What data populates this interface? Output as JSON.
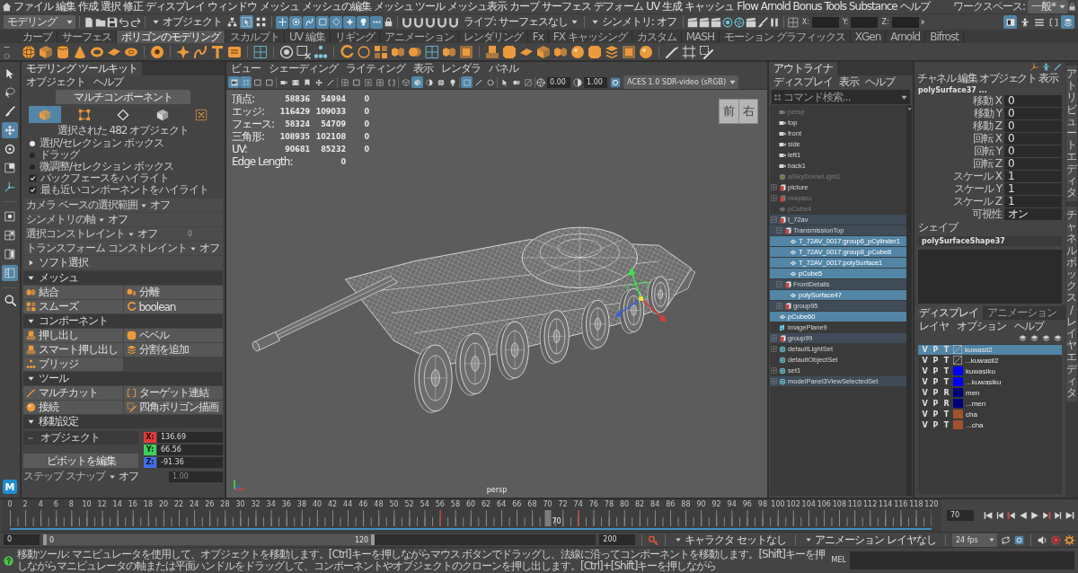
{
  "menu_bar": {
    "items": [
      "ファイル",
      "編集",
      "作成",
      "選択",
      "修正",
      "ディスプレイ",
      "ウィンドウ",
      "メッシュ",
      "メッシュの編集",
      "メッシュ ツール",
      "メッシュ表示",
      "カーブ",
      "サーフェス",
      "デフォーム",
      "UV",
      "生成",
      "キャッシュ",
      "Flow",
      "Arnold",
      "Bonus Tools",
      "Substance",
      "ヘルプ"
    ],
    "workspace_label": "ワークスペース:",
    "workspace": "一般*"
  },
  "status_line": {
    "mode": "モデリング",
    "selection_type": "オブジェクト",
    "select_modes": [
      {
        "kind": "hierarchy",
        "selected": false
      },
      {
        "kind": "arrow-box",
        "selected": true
      },
      {
        "kind": "dots-box",
        "selected": false
      }
    ],
    "masks": [
      {
        "kind": "cross",
        "on": true
      },
      {
        "kind": "dot-circle",
        "on": true
      },
      {
        "kind": "swirl",
        "on": true
      },
      {
        "kind": "square",
        "on": true
      },
      {
        "kind": "diamond",
        "on": true
      },
      {
        "kind": "sparkle",
        "on": true
      },
      {
        "kind": "bulb",
        "on": true
      },
      {
        "kind": "dots",
        "on": true
      }
    ],
    "live_surface": "ライブ: サーフェスなし",
    "symmetry": "シンメトリ: オフ",
    "coordinate_labels": [
      "X:",
      "Y:",
      "Z:"
    ],
    "panel_toggles": [
      {
        "kind": "view",
        "on": true
      },
      {
        "kind": "person",
        "on": false
      },
      {
        "kind": "lines",
        "on": false
      },
      {
        "kind": "bracket",
        "on": false
      },
      {
        "kind": "stack",
        "on": true
      }
    ]
  },
  "shelf": {
    "tabs": [
      {
        "label": "カーブ",
        "selected": false
      },
      {
        "label": "サーフェス",
        "selected": false
      },
      {
        "label": "ポリゴンのモデリング",
        "selected": true
      },
      {
        "label": "スカルプト",
        "selected": false
      },
      {
        "label": "UV 編集",
        "selected": false
      },
      {
        "label": "リギング",
        "selected": false
      },
      {
        "label": "アニメーション",
        "selected": false
      },
      {
        "label": "レンダリング",
        "selected": false
      },
      {
        "label": "Fx",
        "selected": false
      },
      {
        "label": "FX キャッシング",
        "selected": false
      },
      {
        "label": "カスタム",
        "selected": false
      },
      {
        "label": "MASH",
        "selected": false
      },
      {
        "label": "モーション グラフィックス",
        "selected": false
      },
      {
        "label": "XGen",
        "selected": false
      },
      {
        "label": "Arnold",
        "selected": false
      },
      {
        "label": "Bifrost",
        "selected": false
      }
    ]
  },
  "toolbox": {
    "tools": [
      {
        "kind": "arrow",
        "selected": false
      },
      {
        "kind": "lasso",
        "selected": false
      },
      {
        "kind": "brush",
        "selected": false
      },
      {
        "kind": "move",
        "selected": true
      },
      {
        "kind": "rotate",
        "selected": false
      },
      {
        "kind": "scale",
        "selected": false
      },
      {
        "kind": "axes",
        "selected": false
      }
    ],
    "layouts": [
      {
        "kind": "view-single",
        "selected": false
      },
      {
        "kind": "view-four",
        "selected": false
      },
      {
        "kind": "view-two",
        "selected": false
      },
      {
        "kind": "view-outliner",
        "selected": true
      }
    ],
    "logo": "M"
  },
  "modeling_toolkit": {
    "title": "モデリング ツールキット",
    "menu": [
      "オブジェクト",
      "ヘルプ"
    ],
    "multi_component": "マルチコンポーネント",
    "modes": [
      {
        "kind": "object",
        "selected": true
      },
      {
        "kind": "vertex",
        "selected": false
      },
      {
        "kind": "edge",
        "selected": false
      },
      {
        "kind": "face",
        "selected": false
      },
      {
        "kind": "uv",
        "selected": false
      }
    ],
    "selection_info": "選択された 482 オブジェクト",
    "pick_styles": [
      {
        "label": "選択/セレクション ボックス",
        "selected": true
      },
      {
        "label": "ドラッグ",
        "selected": false
      },
      {
        "label": "微調整/セレクション ボックス",
        "selected": false
      }
    ],
    "highlights": [
      {
        "label": "バックフェースをハイライト",
        "checked": true
      },
      {
        "label": "最も近いコンポーネントをハイライト",
        "checked": true
      }
    ],
    "settings": [
      {
        "label": "カメラ ベースの選択範囲",
        "value": "オフ"
      },
      {
        "label": "シンメトリの軸",
        "value": "オフ"
      },
      {
        "label": "選択コンストレイント",
        "value": "オフ",
        "amount": "0"
      },
      {
        "label": "トランスフォーム コンストレイント",
        "value": "オフ"
      }
    ],
    "sections": [
      {
        "kind": "options",
        "title": "ソフト選択",
        "expanded": false
      },
      {
        "kind": "buttons",
        "title": "メッシュ",
        "expanded": true,
        "buttons": [
          {
            "label": "結合",
            "kind": "combine"
          },
          {
            "label": "分離",
            "kind": "separate"
          },
          {
            "label": "スムーズ",
            "kind": "smooth"
          },
          {
            "label": "boolean",
            "kind": "boolean"
          }
        ]
      },
      {
        "kind": "buttons",
        "title": "コンポーネント",
        "expanded": true,
        "buttons": [
          {
            "label": "押し出し",
            "kind": "extrude"
          },
          {
            "label": "ベベル",
            "kind": "bevel"
          },
          {
            "label": "スマート押し出し",
            "kind": "smart_extrude"
          },
          {
            "label": "分割を追加",
            "kind": "add_divisions"
          },
          {
            "label": "ブリッジ",
            "kind": "bridge"
          }
        ]
      },
      {
        "kind": "buttons",
        "title": "ツール",
        "expanded": true,
        "buttons": [
          {
            "label": "マルチカット",
            "kind": "multi_cut"
          },
          {
            "label": "ターゲット連結",
            "kind": "target_weld"
          },
          {
            "label": "接続",
            "kind": "connect"
          },
          {
            "label": "四角ポリゴン描画",
            "kind": "quad_draw"
          }
        ]
      },
      {
        "kind": "transform",
        "title": "移動設定",
        "expanded": true,
        "space": "オブジェクト",
        "coords": [
          {
            "axis": "X:",
            "value": "136.69",
            "color": "#e23b3b"
          },
          {
            "axis": "Y:",
            "value": "66.56",
            "color": "#3ed25a"
          },
          {
            "axis": "Z:",
            "value": "-91.36",
            "color": "#3f6ee8"
          }
        ],
        "pivot_button": "ピボットを編集",
        "step_snap": {
          "label": "ステップ スナップ",
          "value": "オフ",
          "amount": "1.00"
        }
      }
    ]
  },
  "viewport": {
    "menu": [
      "ビュー",
      "シェーディング",
      "ライティング",
      "表示",
      "レンダラ",
      "パネル"
    ],
    "toolbar_groups": [
      [
        {
          "kind": "camera-box",
          "on": true
        },
        {
          "kind": "frame",
          "on": true
        },
        {
          "kind": "square",
          "on": false
        },
        {
          "kind": "square",
          "on": false
        }
      ],
      [
        {
          "kind": "camera",
          "on": false
        },
        {
          "kind": "film",
          "on": false
        },
        {
          "kind": "bookmark",
          "on": false
        },
        {
          "kind": "move",
          "on": false
        },
        {
          "kind": "pen",
          "on": false
        }
      ],
      [
        {
          "kind": "grid",
          "on": false
        },
        {
          "kind": "square",
          "on": false
        },
        {
          "kind": "plus-box",
          "on": false
        },
        {
          "kind": "grid",
          "on": false
        },
        {
          "kind": "bracket",
          "on": false
        }
      ],
      [
        {
          "kind": "wire-cube",
          "on": false
        },
        {
          "kind": "cube",
          "on": true
        },
        {
          "kind": "half-circle",
          "on": false
        },
        {
          "kind": "globe",
          "on": false
        },
        {
          "kind": "bulb",
          "on": false
        }
      ],
      [
        {
          "kind": "square",
          "on": true
        },
        {
          "kind": "pen",
          "on": false
        },
        {
          "kind": "ring",
          "on": false
        }
      ],
      [
        {
          "kind": "arrow",
          "on": false
        },
        {
          "kind": "cubes",
          "on": false
        },
        {
          "kind": "slash",
          "on": false
        }
      ]
    ],
    "exposure": "0.00",
    "gamma": "1.00",
    "color_space": "ACES 1.0 SDR-video (sRGB)",
    "hud": [
      {
        "label": "頂点:",
        "values": [
          "58836",
          "54994",
          "0"
        ]
      },
      {
        "label": "エッジ:",
        "values": [
          "116429",
          "109033",
          "0"
        ]
      },
      {
        "label": "フェース:",
        "values": [
          "58324",
          "54709",
          "0"
        ]
      },
      {
        "label": "三角形:",
        "values": [
          "108935",
          "102108",
          "0"
        ]
      },
      {
        "label": "UV:",
        "values": [
          "90681",
          "85232",
          "0"
        ]
      },
      {
        "label": "Edge Length:",
        "values": [
          "0"
        ]
      }
    ],
    "view_cube": [
      "前",
      "右"
    ],
    "camera": "persp"
  },
  "outliner": {
    "title": "アウトライナ",
    "menu": [
      "ディスプレイ",
      "表示",
      "ヘルプ"
    ],
    "search": {
      "placeholder": "コマンド検索..."
    },
    "items": [
      {
        "name": "persp",
        "kind": "camera",
        "hidden": true,
        "selected": false,
        "highlighted": false
      },
      {
        "name": "top",
        "kind": "camera",
        "hidden": false,
        "selected": false,
        "highlighted": false
      },
      {
        "name": "front",
        "kind": "camera",
        "hidden": false,
        "selected": false,
        "highlighted": false
      },
      {
        "name": "side",
        "kind": "camera",
        "hidden": false,
        "selected": false,
        "highlighted": false
      },
      {
        "name": "left1",
        "kind": "camera",
        "hidden": false,
        "selected": false,
        "highlighted": false
      },
      {
        "name": "back1",
        "kind": "camera",
        "hidden": false,
        "selected": false,
        "highlighted": false
      },
      {
        "name": "aiSkyDomeLight1",
        "kind": "light",
        "hidden": true,
        "selected": false,
        "highlighted": false
      },
      {
        "name": "picture",
        "kind": "group",
        "expanded": false,
        "hidden": false,
        "selected": false,
        "highlighted": false
      },
      {
        "name": "mayasu",
        "kind": "group",
        "expanded": false,
        "hidden": true,
        "selected": false,
        "highlighted": false
      },
      {
        "name": "pCube4",
        "kind": "mesh",
        "hidden": true,
        "selected": false,
        "highlighted": false
      },
      {
        "name": "t_72av",
        "kind": "group",
        "expanded": true,
        "hidden": false,
        "selected": false,
        "highlighted": true,
        "children": [
          {
            "name": "TransmissionTop",
            "kind": "group",
            "expanded": true,
            "hidden": false,
            "selected": false,
            "highlighted": true,
            "children": [
              {
                "name": "T_72AV_0017:group6_pCylinder1",
                "kind": "mesh",
                "hidden": false,
                "selected": true,
                "highlighted": false
              },
              {
                "name": "T_72AV_0017:group8_pCube8",
                "kind": "mesh",
                "hidden": false,
                "selected": true,
                "highlighted": false
              },
              {
                "name": "T_72AV_0017:polySurface1",
                "kind": "mesh",
                "hidden": false,
                "selected": true,
                "highlighted": false
              },
              {
                "name": "pCube5",
                "kind": "mesh",
                "hidden": false,
                "selected": true,
                "highlighted": false
              }
            ]
          },
          {
            "name": "FrontDetails",
            "kind": "group",
            "expanded": true,
            "hidden": false,
            "selected": false,
            "highlighted": true,
            "children": [
              {
                "name": "polySurface47",
                "kind": "mesh",
                "hidden": false,
                "selected": true,
                "highlighted": false
              }
            ]
          },
          {
            "name": "group95",
            "kind": "group",
            "expanded": false,
            "hidden": false,
            "selected": false,
            "highlighted": true
          }
        ]
      },
      {
        "name": "pCube60",
        "kind": "mesh",
        "hidden": false,
        "selected": true,
        "highlighted": false
      },
      {
        "name": "imagePlane9",
        "kind": "image_plane",
        "hidden": false,
        "selected": false,
        "highlighted": false
      },
      {
        "name": "group99",
        "kind": "group",
        "expanded": false,
        "hidden": false,
        "selected": false,
        "highlighted": true
      },
      {
        "name": "defaultLightSet",
        "kind": "set",
        "expanded": false,
        "hidden": false,
        "selected": false,
        "highlighted": false
      },
      {
        "name": "defaultObjectSet",
        "kind": "set",
        "hidden": false,
        "selected": false,
        "highlighted": false
      },
      {
        "name": "set1",
        "kind": "set",
        "expanded": false,
        "hidden": false,
        "selected": false,
        "highlighted": false
      },
      {
        "name": "modelPanel3ViewSelectedSet",
        "kind": "set",
        "expanded": false,
        "hidden": false,
        "selected": false,
        "highlighted": true
      }
    ]
  },
  "channel_box": {
    "menu": [
      "チャネル",
      "編集",
      "オブジェクト",
      "表示"
    ],
    "object_name": "polySurface37 ...",
    "channels": [
      {
        "name": "移動 X",
        "value": "0"
      },
      {
        "name": "移動 Y",
        "value": "0"
      },
      {
        "name": "移動 Z",
        "value": "0"
      },
      {
        "name": "回転 X",
        "value": "0"
      },
      {
        "name": "回転 Y",
        "value": "0"
      },
      {
        "name": "回転 Z",
        "value": "0"
      },
      {
        "name": "スケール X",
        "value": "1"
      },
      {
        "name": "スケール Y",
        "value": "1"
      },
      {
        "name": "スケール Z",
        "value": "1"
      },
      {
        "name": "可視性",
        "value": "オン"
      }
    ],
    "shapes_label": "シェイプ",
    "shape_name": "polySurfaceShape37"
  },
  "layer_editor": {
    "tabs": [
      {
        "label": "ディスプレイ",
        "selected": true
      },
      {
        "label": "アニメーション",
        "selected": false
      }
    ],
    "menu": [
      "レイヤ",
      "オプション",
      "ヘルプ"
    ],
    "layers": [
      {
        "visibility": "V",
        "playback": "P",
        "display": "T",
        "name": "kuwasil2",
        "selected": true
      },
      {
        "visibility": "V",
        "playback": "P",
        "display": "T",
        "name": "...kuwasil2",
        "selected": false
      },
      {
        "visibility": "V",
        "playback": "P",
        "display": "T",
        "color": "#0000ff",
        "name": "kuwasiku",
        "selected": false
      },
      {
        "visibility": "V",
        "playback": "P",
        "display": "T",
        "color": "#0000ff",
        "name": "...kuwasiku",
        "selected": false
      },
      {
        "visibility": "V",
        "playback": "P",
        "display": "R",
        "color": "#00007a",
        "name": "men",
        "selected": false
      },
      {
        "visibility": "V",
        "playback": "P",
        "display": "R",
        "color": "#00007a",
        "name": "...men",
        "selected": false
      },
      {
        "visibility": "V",
        "playback": "P",
        "display": "T",
        "color": "#a0522d",
        "name": "cha",
        "selected": false
      },
      {
        "visibility": "V",
        "playback": "P",
        "display": "T",
        "color": "#a0522d",
        "name": "...cha",
        "selected": false
      }
    ]
  },
  "side_tabs": [
    "アトリビュートエディタ",
    "チャネルボックス/レイヤエディタ"
  ],
  "time_slider": {
    "ticks": [
      {
        "label": "0",
        "key": false,
        "current": false
      },
      {
        "label": "2",
        "key": false,
        "current": false
      },
      {
        "label": "4",
        "key": false,
        "current": false
      },
      {
        "label": "6",
        "key": false,
        "current": false
      },
      {
        "label": "8",
        "key": false,
        "current": false
      },
      {
        "label": "10",
        "key": false,
        "current": false
      },
      {
        "label": "12",
        "key": false,
        "current": false
      },
      {
        "label": "14",
        "key": false,
        "current": false
      },
      {
        "label": "16",
        "key": false,
        "current": false
      },
      {
        "label": "18",
        "key": false,
        "current": false
      },
      {
        "label": "20",
        "key": false,
        "current": false
      },
      {
        "label": "22",
        "key": false,
        "current": false
      },
      {
        "label": "24",
        "key": false,
        "current": false
      },
      {
        "label": "26",
        "key": false,
        "current": false
      },
      {
        "label": "28",
        "key": false,
        "current": false
      },
      {
        "label": "30",
        "key": false,
        "current": false
      },
      {
        "label": "32",
        "key": false,
        "current": false
      },
      {
        "label": "34",
        "key": false,
        "current": false
      },
      {
        "label": "36",
        "key": false,
        "current": false
      },
      {
        "label": "38",
        "key": false,
        "current": false
      },
      {
        "label": "40",
        "key": false,
        "current": false
      },
      {
        "label": "42",
        "key": false,
        "current": false
      },
      {
        "label": "44",
        "key": false,
        "current": false
      },
      {
        "label": "46",
        "key": false,
        "current": false
      },
      {
        "label": "48",
        "key": false,
        "current": false
      },
      {
        "label": "50",
        "key": false,
        "current": false
      },
      {
        "label": "52",
        "key": false,
        "current": false
      },
      {
        "label": "54",
        "key": false,
        "current": false
      },
      {
        "label": "56",
        "key": true,
        "current": false
      },
      {
        "label": "58",
        "key": false,
        "current": false
      },
      {
        "label": "60",
        "key": false,
        "current": false
      },
      {
        "label": "62",
        "key": false,
        "current": false
      },
      {
        "label": "64",
        "key": false,
        "current": false
      },
      {
        "label": "66",
        "key": false,
        "current": false
      },
      {
        "label": "68",
        "key": false,
        "current": false
      },
      {
        "label": "70",
        "key": false,
        "current": true
      },
      {
        "label": "72",
        "key": false,
        "current": false
      },
      {
        "label": "74",
        "key": true,
        "current": false
      },
      {
        "label": "76",
        "key": false,
        "current": false
      },
      {
        "label": "78",
        "key": false,
        "current": false
      },
      {
        "label": "80",
        "key": false,
        "current": false
      },
      {
        "label": "82",
        "key": false,
        "current": false
      },
      {
        "label": "84",
        "key": false,
        "current": false
      },
      {
        "label": "86",
        "key": false,
        "current": false
      },
      {
        "label": "88",
        "key": false,
        "current": false
      },
      {
        "label": "90",
        "key": false,
        "current": false
      },
      {
        "label": "92",
        "key": false,
        "current": false
      },
      {
        "label": "94",
        "key": false,
        "current": false
      },
      {
        "label": "96",
        "key": false,
        "current": false
      },
      {
        "label": "98",
        "key": false,
        "current": false
      },
      {
        "label": "100",
        "key": false,
        "current": false
      },
      {
        "label": "102",
        "key": false,
        "current": false
      },
      {
        "label": "104",
        "key": false,
        "current": false
      },
      {
        "label": "106",
        "key": false,
        "current": false
      },
      {
        "label": "108",
        "key": false,
        "current": false
      },
      {
        "label": "110",
        "key": false,
        "current": false
      },
      {
        "label": "112",
        "key": false,
        "current": false
      },
      {
        "label": "114",
        "key": false,
        "current": false
      },
      {
        "label": "116",
        "key": false,
        "current": false
      },
      {
        "label": "118",
        "key": false,
        "current": false
      },
      {
        "label": "120",
        "key": false,
        "current": false
      }
    ],
    "current_label": "70",
    "current_time": "70"
  },
  "range": {
    "start": "0",
    "inner_start": "0",
    "inner_end": "120",
    "end": "200",
    "level": 0.6,
    "character_set": "キャラクタ セットなし",
    "animation_layer": "アニメーション レイヤなし",
    "fps": "24 fps",
    "auto_key": true
  },
  "command_line": {
    "help": "移動ツール: マニピュレータを使用して、オブジェクトを移動します。[Ctrl]キーを押しながらマウス ボタンでドラッグし、法線に沿ってコンポーネントを移動します。[Shift]キーを押しながらマニピュレータの軸または平面ハンドルをドラッグして、コンポーネントやオブジェクトのクローンを押し出します。[Ctrl]+[Shift]キーを押しながら",
    "language": "MEL"
  }
}
